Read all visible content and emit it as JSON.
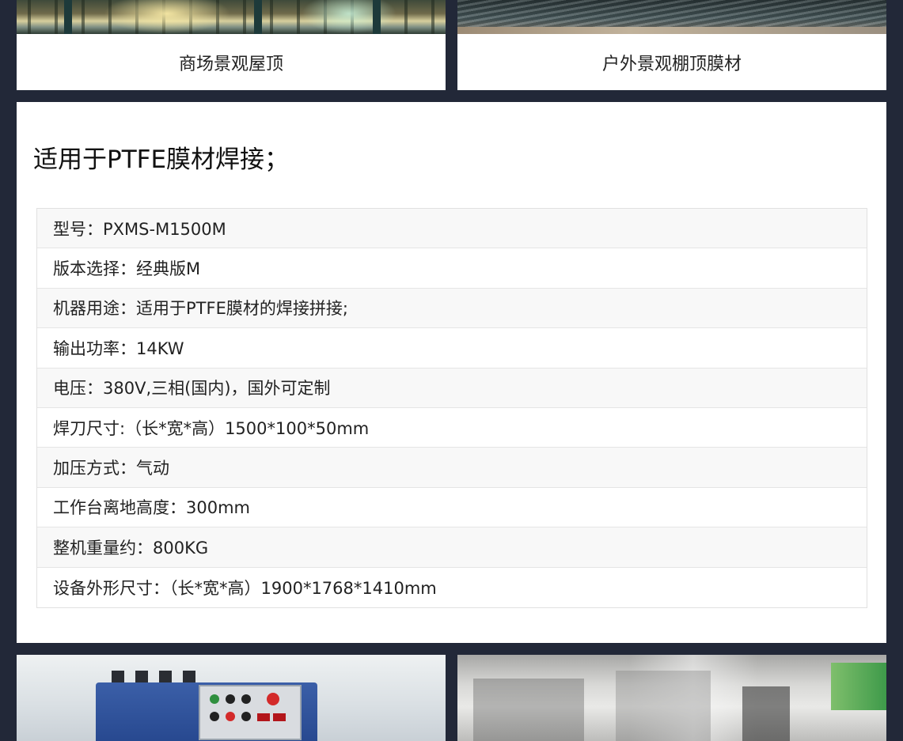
{
  "top_cards": [
    {
      "caption": "商场景观屋顶"
    },
    {
      "caption": "户外景观棚顶膜材"
    }
  ],
  "main": {
    "title": "适用于PTFE膜材焊接；",
    "specs": [
      "型号：PXMS-M1500M",
      "版本选择：经典版M",
      "机器用途：适用于PTFE膜材的焊接拼接;",
      "输出功率：14KW",
      "电压：380V,三相(国内)，国外可定制",
      "焊刀尺寸:（长*宽*高）1500*100*50mm",
      "加压方式：气动",
      "工作台离地高度：300mm",
      "整机重量约：800KG",
      "设备外形尺寸：（长*宽*高）1900*1768*1410mm"
    ]
  },
  "colors": {
    "background": "#222838",
    "card": "#ffffff",
    "row_alt": "#f8f8f8",
    "machine_blue": "#2f52a0"
  }
}
